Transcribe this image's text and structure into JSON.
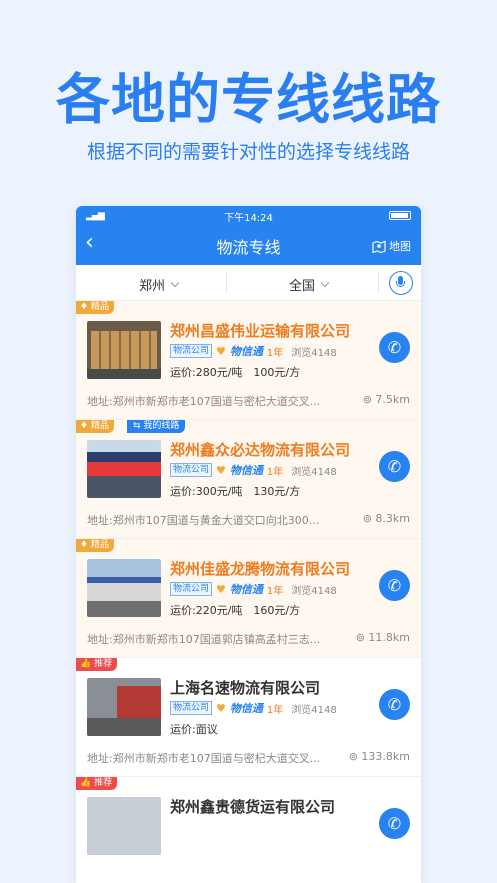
{
  "hero": {
    "title": "各地的专线线路",
    "subtitle": "根据不同的需要针对性的选择专线线路"
  },
  "status": {
    "time": "下午14:24",
    "signal": "▂▄▆"
  },
  "nav": {
    "back": "‹",
    "title": "物流专线",
    "map_label": "地图"
  },
  "filters": {
    "city": "郑州",
    "region": "全国"
  },
  "colors": {
    "brand": "#2783ef",
    "featured": "#ee7d22",
    "recommend": "#ef4d4d"
  },
  "listings": [
    {
      "badge": "精品",
      "route_badge": "",
      "company": "郑州昌盛伟业运输有限公司",
      "type": "物流公司",
      "cert": "物信通",
      "years": "1年",
      "views": "浏览4148",
      "price": "运价:280元/吨　100元/方",
      "address": "地址:郑州市新郑市老107国道与密杞大道交叉...",
      "distance": "7.5km"
    },
    {
      "badge": "精品",
      "route_badge": "我的线路",
      "company": "郑州鑫众必达物流有限公司",
      "type": "物流公司",
      "cert": "物信通",
      "years": "1年",
      "views": "浏览4148",
      "price": "运价:300元/吨　130元/方",
      "address": "地址:郑州市107国道与黄金大道交口向北300...",
      "distance": "8.3km"
    },
    {
      "badge": "精品",
      "route_badge": "",
      "company": "郑州佳盛龙腾物流有限公司",
      "type": "物流公司",
      "cert": "物信通",
      "years": "1年",
      "views": "浏览4148",
      "price": "运价:220元/吨　160元/方",
      "address": "地址:郑州市新郑市107国道郭店镇高孟村三志...",
      "distance": "11.8km"
    },
    {
      "badge": "推荐",
      "route_badge": "",
      "company": "上海名速物流有限公司",
      "type": "物流公司",
      "cert": "物信通",
      "years": "1年",
      "views": "浏览4148",
      "price": "运价:面议",
      "address": "地址:郑州市新郑市老107国道与密杞大道交叉...",
      "distance": "133.8km"
    },
    {
      "badge": "推荐",
      "route_badge": "",
      "company": "郑州鑫贵德货运有限公司"
    }
  ]
}
